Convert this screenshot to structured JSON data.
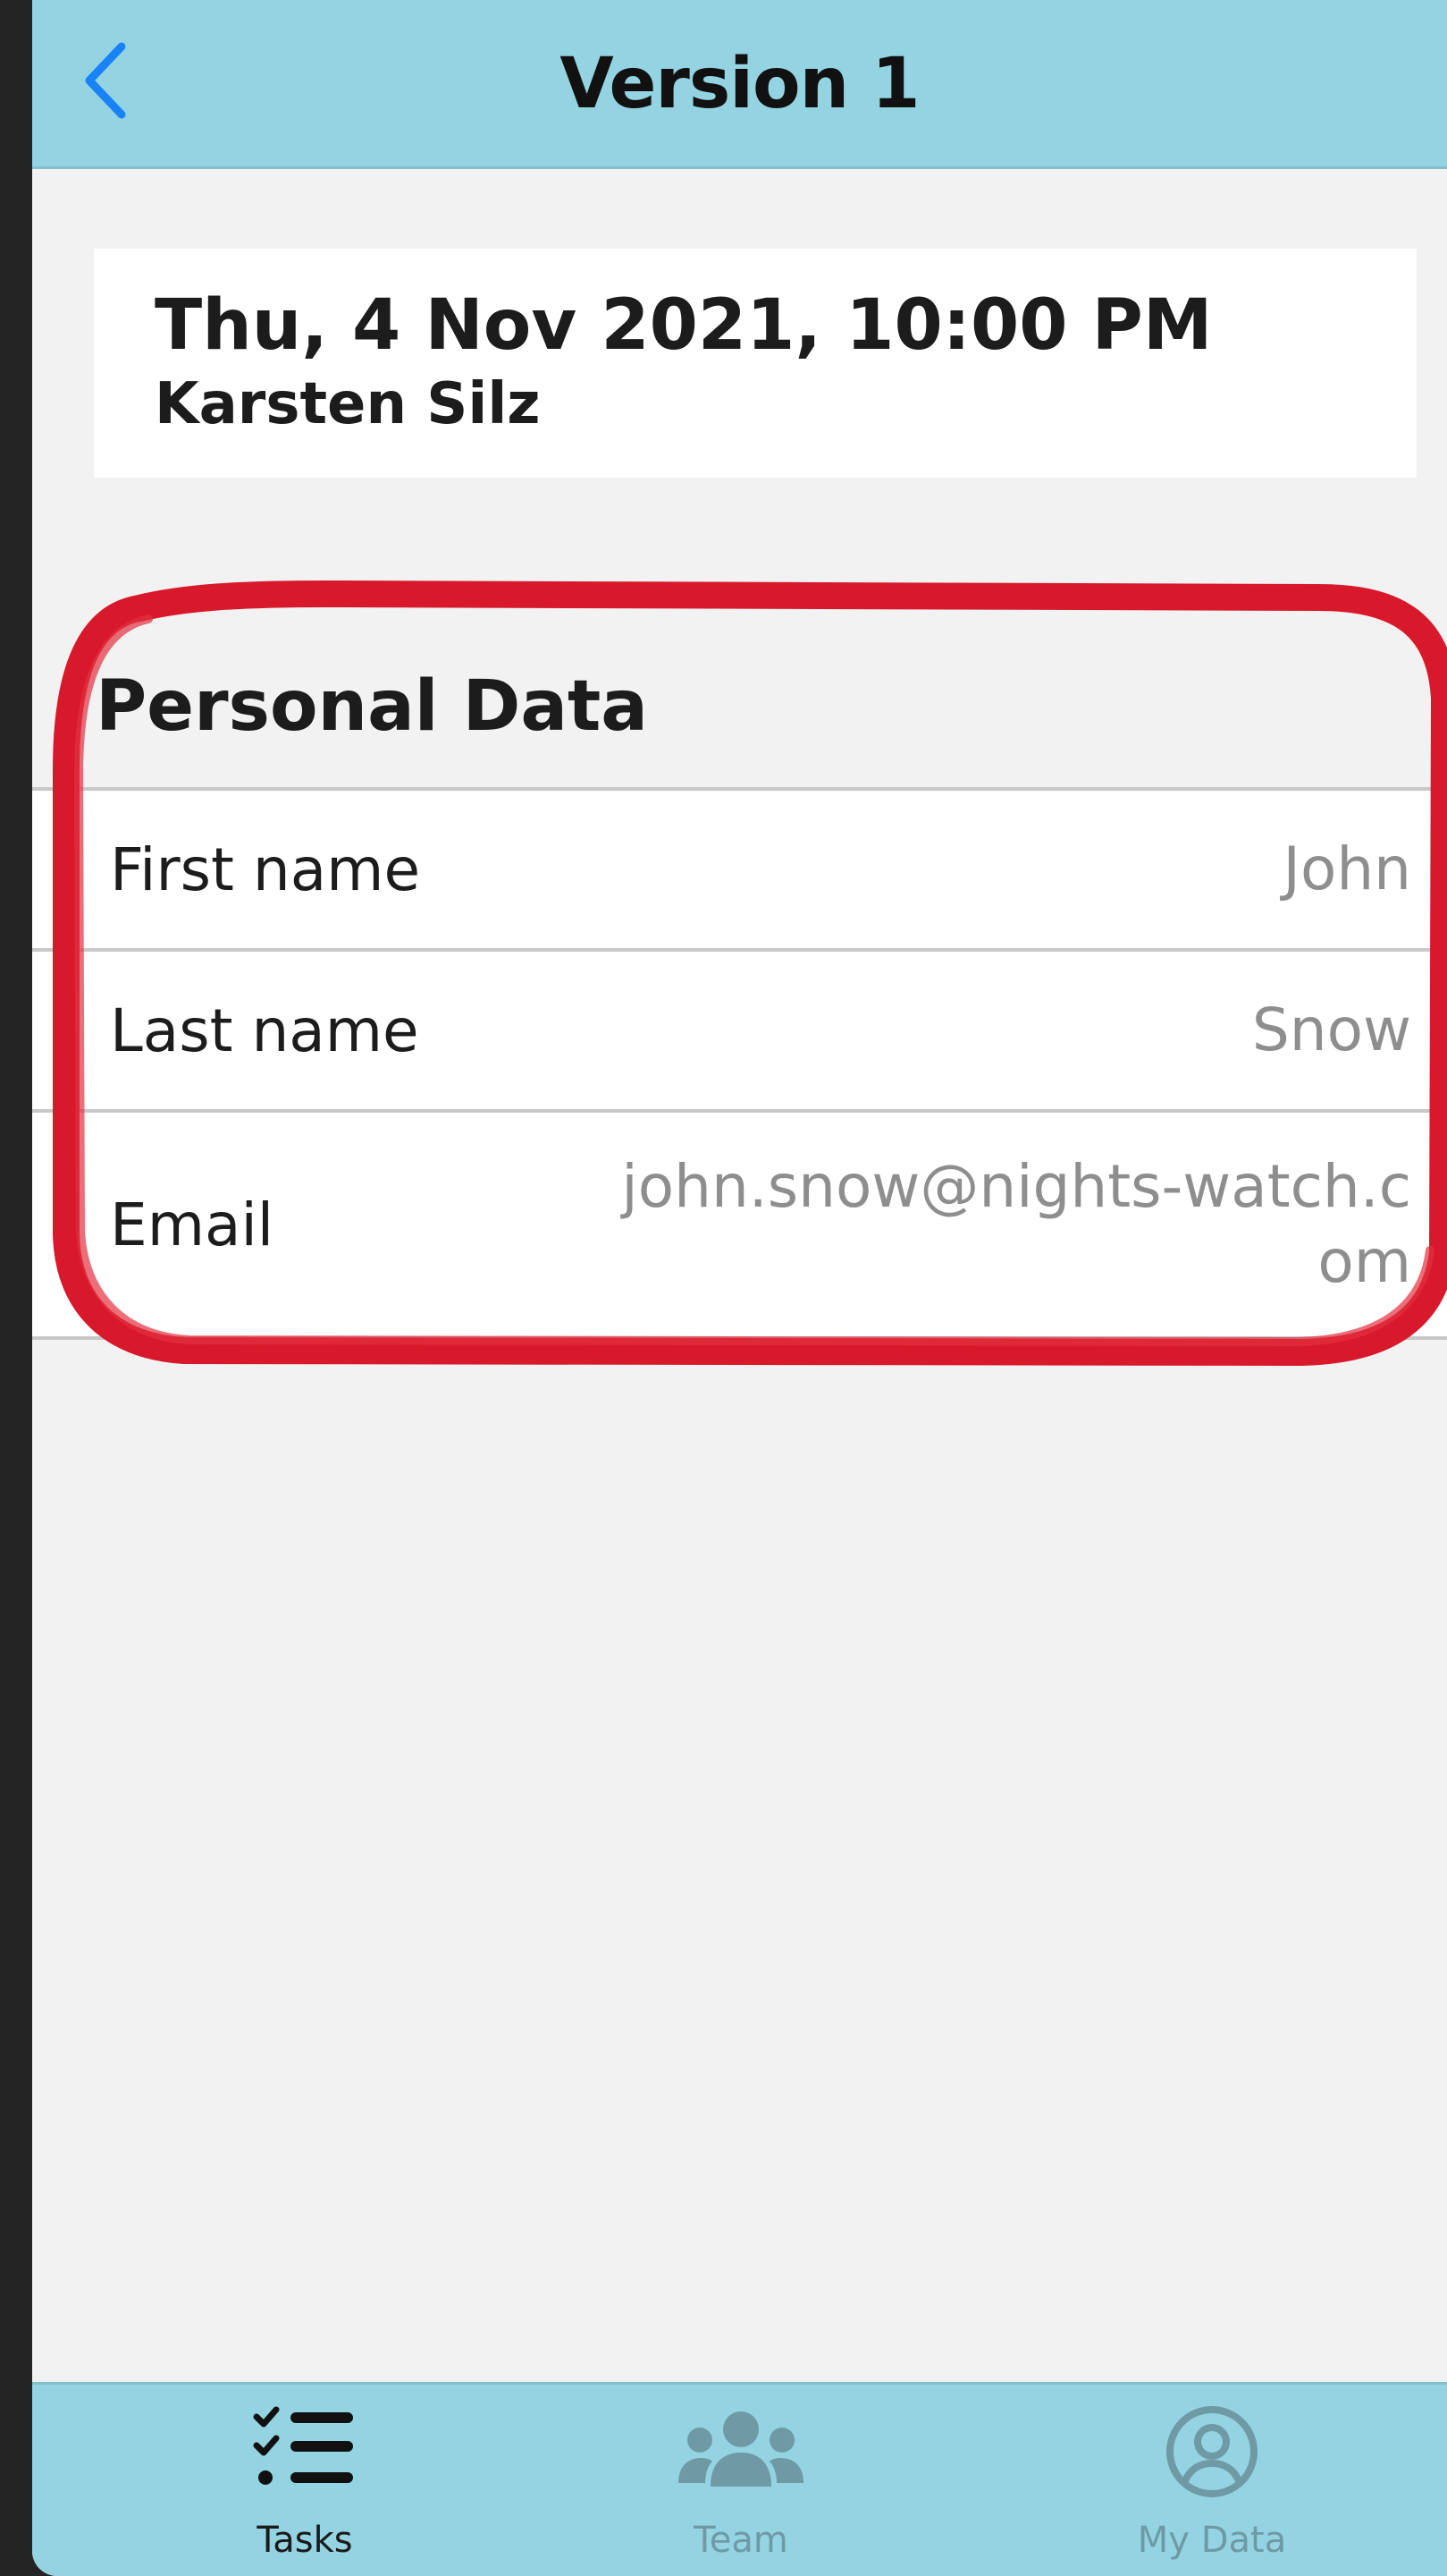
{
  "navbar": {
    "title": "Version 1",
    "back_icon": "chevron-left-icon"
  },
  "info_card": {
    "date": "Thu, 4 Nov 2021, 10:00 PM",
    "author": "Karsten Silz"
  },
  "personal_data": {
    "title": "Personal Data",
    "rows": [
      {
        "label": "First name",
        "value": "John"
      },
      {
        "label": "Last name",
        "value": "Snow"
      },
      {
        "label": "Email",
        "value": "john.snow@nights-watch.com"
      }
    ]
  },
  "tabbar": {
    "tabs": [
      {
        "label": "Tasks",
        "icon": "task-list-icon",
        "active": true
      },
      {
        "label": "Team",
        "icon": "team-icon",
        "active": false
      },
      {
        "label": "My Data",
        "icon": "user-circle-icon",
        "active": false
      }
    ]
  },
  "colors": {
    "bar_bg": "#93d3e2",
    "accent_blue": "#1a82f7",
    "highlight_red": "#d8192b",
    "inactive_tab": "#6f9aa5"
  }
}
